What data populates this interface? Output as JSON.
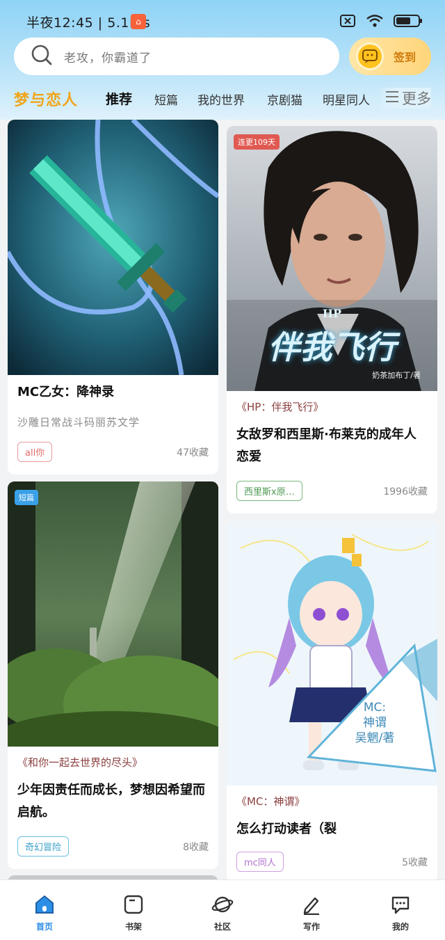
{
  "status_bar": {
    "time_text": "半夜12:45 | 5.1K/s",
    "app_icon_char": "▢",
    "icons": [
      "no-sim-icon",
      "wifi-icon",
      "battery-icon"
    ]
  },
  "search": {
    "placeholder": "老攻，你霸道了"
  },
  "checkin": {
    "label": "签到"
  },
  "tabs": {
    "brand": "梦与恋人",
    "items": [
      "推荐",
      "短篇",
      "我的世界",
      "京剧猫",
      "明星同人"
    ],
    "active_index": 0,
    "more": "更多"
  },
  "cards": {
    "mc_girl": {
      "title": "MC乙女：降神录",
      "desc": "沙雕日常战斗码丽苏文学",
      "tag": "all你",
      "favorites": "47收藏"
    },
    "hp": {
      "badge": "连更109天",
      "cover_title_small": "HP",
      "cover_title": "伴我飞行",
      "cover_author": "奶茶加布丁/著",
      "subtitle": "《HP：伴我飞行》",
      "title": "女敌罗和西里斯·布莱克的成年人恋爱",
      "tag": "西里斯x原…",
      "favorites": "1996收藏"
    },
    "forest": {
      "badge": "短篇",
      "subtitle": "《和你一起去世界的尽头》",
      "title": "少年因责任而成长，梦想因希望而启航。",
      "tag": "奇幻冒险",
      "favorites": "8收藏"
    },
    "mc_god": {
      "cover_line1": "MC:",
      "cover_line2": "神谓",
      "cover_line3": "吴魍/著",
      "subtitle": "《MC：神谓》",
      "title": "怎么打动读者（裂",
      "tag": "mc同人",
      "favorites": "5收藏"
    }
  },
  "bottom_nav": {
    "items": [
      "首页",
      "书架",
      "社区",
      "写作",
      "我的"
    ],
    "active_index": 0
  },
  "colors": {
    "accent": "#2d8ee6",
    "brand": "#f0a51a",
    "checkin": "#ffc21f"
  }
}
